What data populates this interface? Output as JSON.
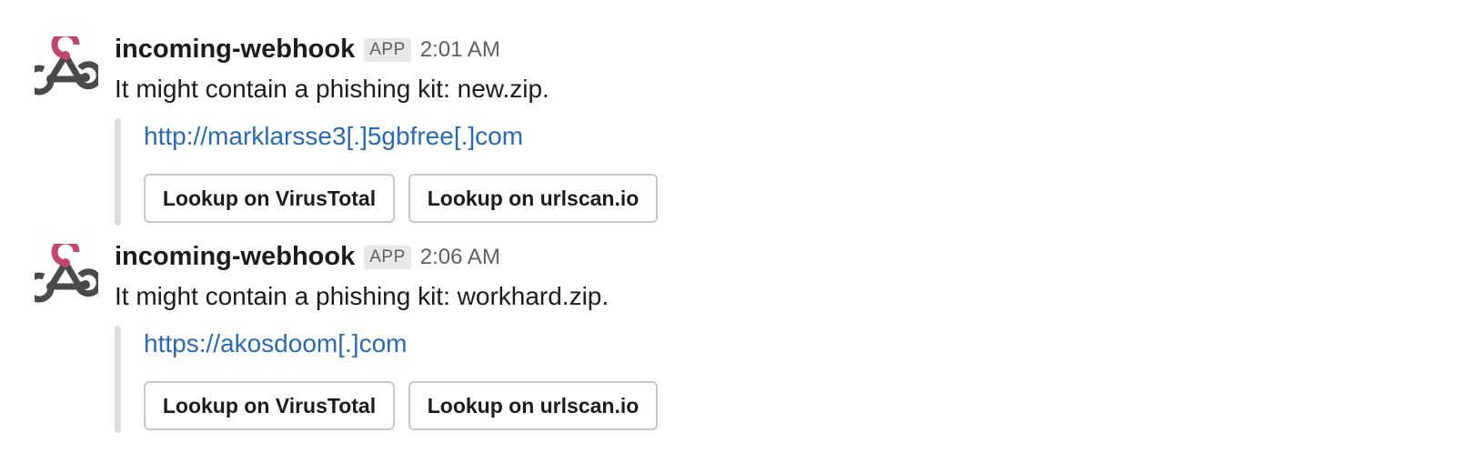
{
  "messages": [
    {
      "sender": "incoming-webhook",
      "badge": "APP",
      "time": "2:01 AM",
      "text": "It might contain a phishing kit: new.zip.",
      "link": "http://marklarsse3[.]5gbfree[.]com",
      "buttons": [
        "Lookup on VirusTotal",
        "Lookup on urlscan.io"
      ]
    },
    {
      "sender": "incoming-webhook",
      "badge": "APP",
      "time": "2:06 AM",
      "text": "It might contain a phishing kit: workhard.zip.",
      "link": "https://akosdoom[.]com",
      "buttons": [
        "Lookup on VirusTotal",
        "Lookup on urlscan.io"
      ]
    }
  ],
  "icons": {
    "avatar": "webhook-icon"
  },
  "colors": {
    "link": "#2a6ab3",
    "webhook_pink": "#c1466a",
    "webhook_dark": "#4a4a4a"
  }
}
